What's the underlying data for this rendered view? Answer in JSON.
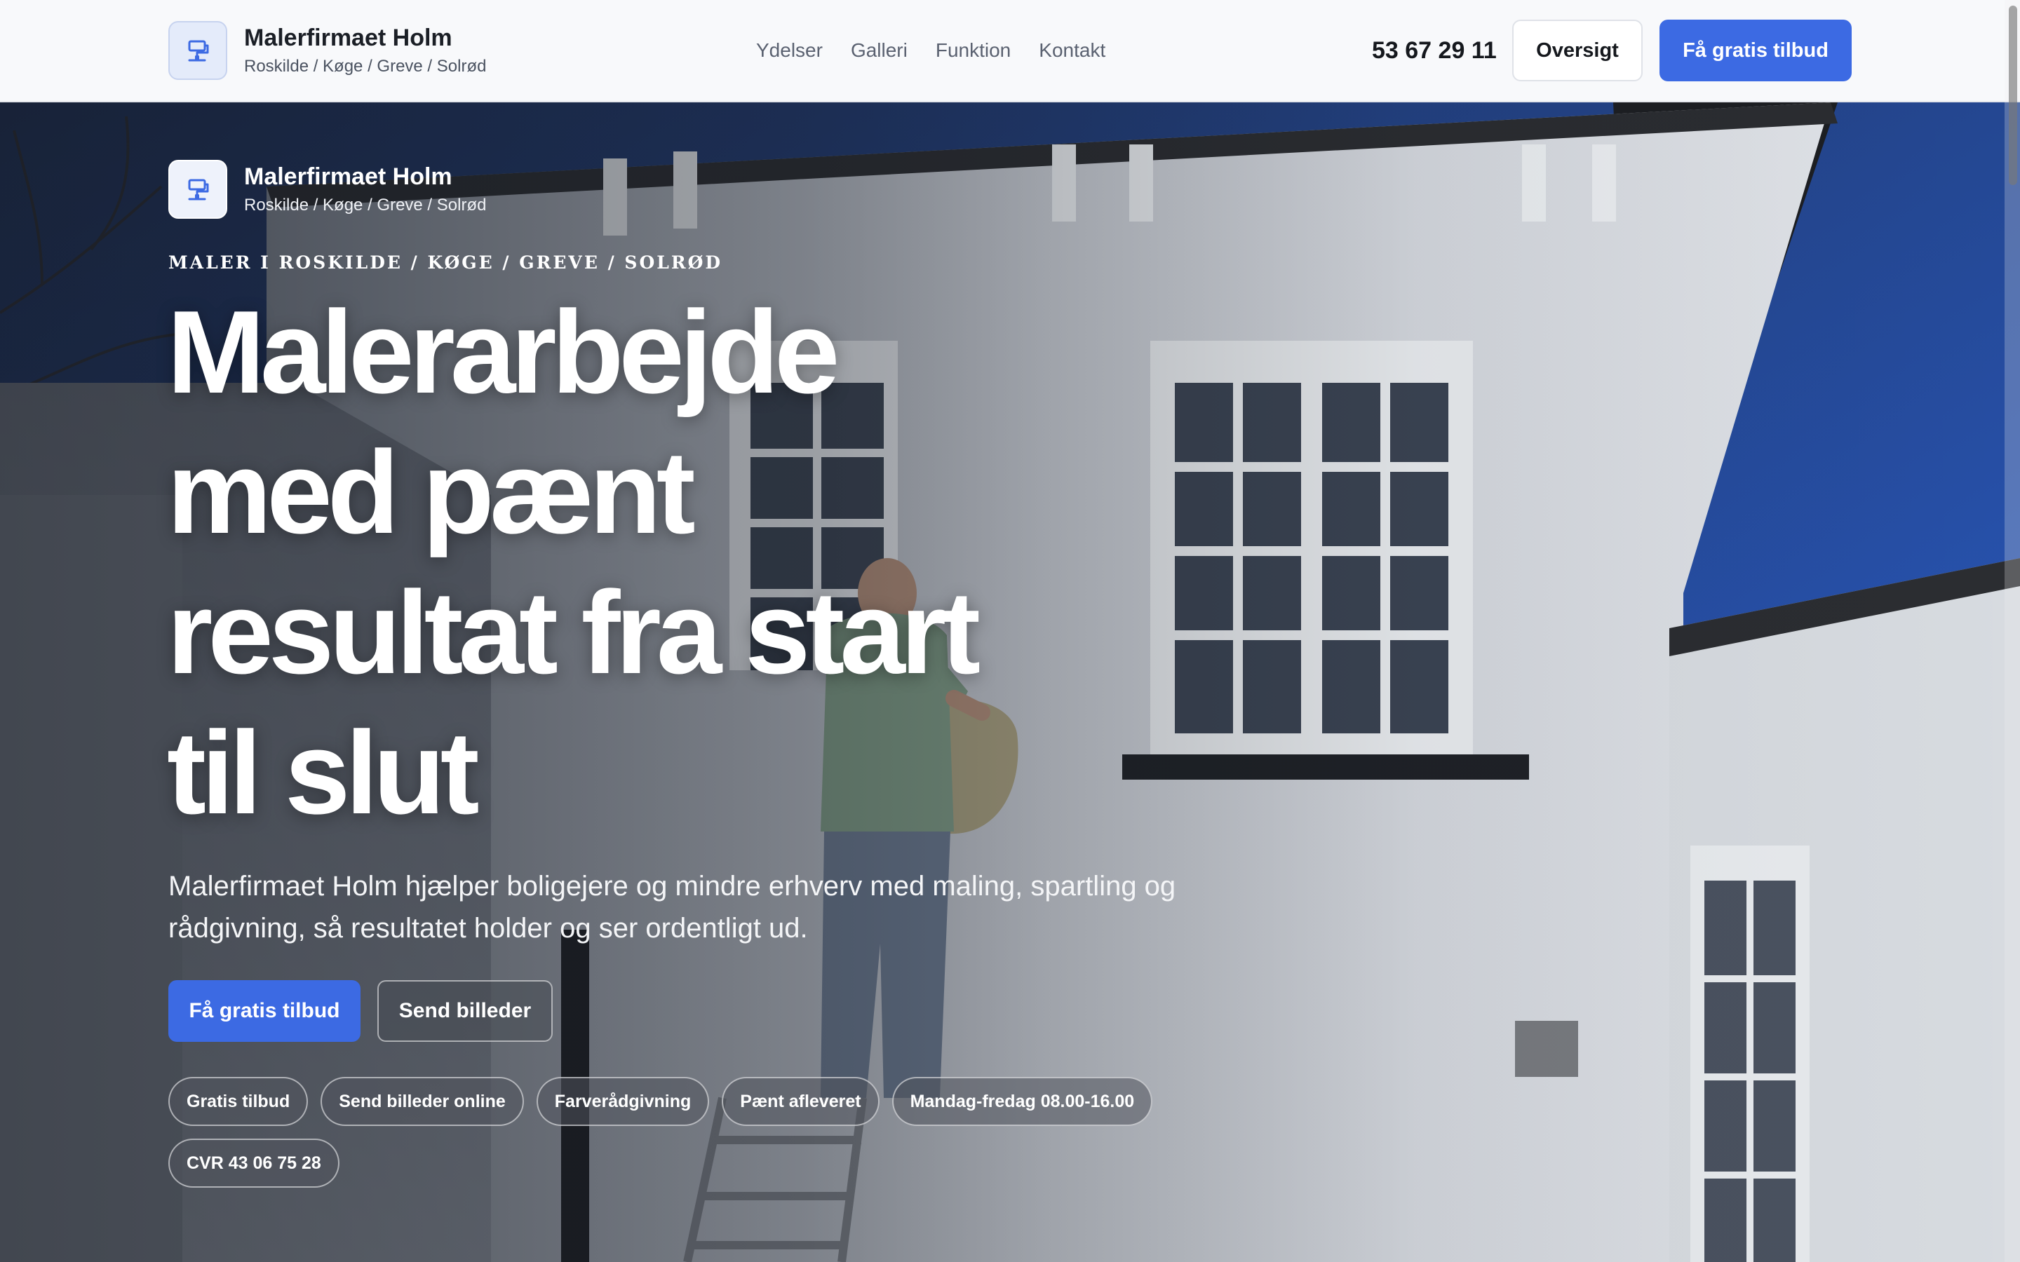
{
  "header": {
    "brand_name": "Malerfirmaet Holm",
    "brand_sub": "Roskilde / Køge / Greve / Solrød",
    "logo_icon": "paint-roller-icon",
    "nav": [
      {
        "label": "Ydelser"
      },
      {
        "label": "Galleri"
      },
      {
        "label": "Funktion"
      },
      {
        "label": "Kontakt"
      }
    ],
    "phone": "53 67 29 11",
    "overview_label": "Oversigt",
    "cta_label": "Få gratis tilbud"
  },
  "hero": {
    "brand_name": "Malerfirmaet Holm",
    "brand_sub": "Roskilde / Køge / Greve / Solrød",
    "eyebrow": "MALER I ROSKILDE / KØGE / GREVE / SOLRØD",
    "headline": "Malerarbejde med pænt resultat fra start til slut",
    "lede": "Malerfirmaet Holm hjælper boligejere og mindre erhverv med maling, spartling og rådgivning, så resultatet holder og ser ordentligt ud.",
    "primary_label": "Få gratis tilbud",
    "secondary_label": "Send billeder",
    "chips": [
      {
        "label": "Gratis tilbud"
      },
      {
        "label": "Send billeder online"
      },
      {
        "label": "Farverådgivning"
      },
      {
        "label": "Pænt afleveret"
      },
      {
        "label": "Mandag-fredag 08.00-16.00"
      },
      {
        "label": "CVR 43 06 75 28"
      }
    ]
  },
  "colors": {
    "accent": "#3c6ae3",
    "header_bg": "#f8f9fb",
    "text_dark": "#15181d"
  }
}
